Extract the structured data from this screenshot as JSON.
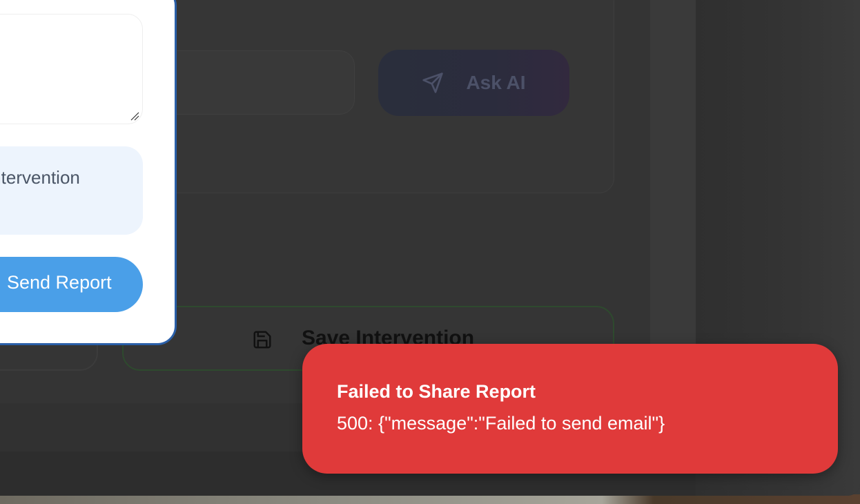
{
  "ai_panel": {
    "ask_button_label": "Ask AI",
    "ask_button_icon": "send-icon"
  },
  "dialog": {
    "intervention_text": "Intervention",
    "send_button_label": "Send Report"
  },
  "actions": {
    "save_button_label": "Save Intervention",
    "save_button_icon": "save-icon"
  },
  "toast": {
    "title": "Failed to Share Report",
    "message": "500: {\"message\":\"Failed to send email\"}",
    "color": "#e03a3a"
  },
  "colors": {
    "dialog_border": "#2a5fa8",
    "send_button": "#4a9fe8",
    "intervention_box": "#edf4fd"
  }
}
